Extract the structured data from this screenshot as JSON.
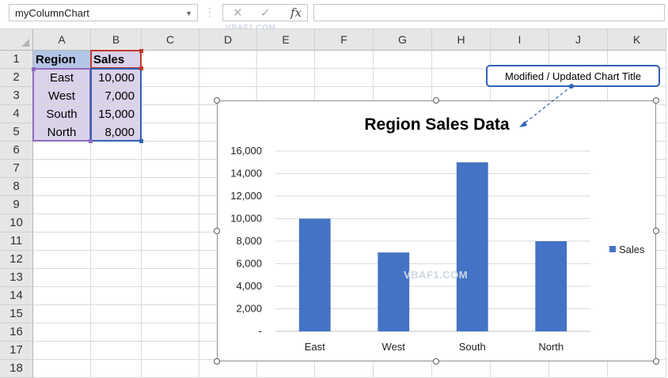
{
  "formula_bar": {
    "name_box": "myColumnChart",
    "cancel_glyph": "✕",
    "enter_glyph": "✓",
    "fx_label": "fx",
    "formula": ""
  },
  "columns": [
    "A",
    "B",
    "C",
    "D",
    "E",
    "F",
    "G",
    "H",
    "I",
    "J",
    "K"
  ],
  "rows": [
    "1",
    "2",
    "3",
    "4",
    "5",
    "6",
    "7",
    "8",
    "9",
    "10",
    "11",
    "12",
    "13",
    "14",
    "15",
    "16",
    "17",
    "18"
  ],
  "cells": {
    "A1": "Region",
    "B1": "Sales",
    "A2": "East",
    "B2": "10,000",
    "A3": "West",
    "B3": "7,000",
    "A4": "South",
    "B4": "15,000",
    "A5": "North",
    "B5": "8,000"
  },
  "callout": {
    "text": "Modified / Updated Chart Title"
  },
  "watermark": {
    "top": "VBAF1.COM",
    "chart": "VBAF1.COM"
  },
  "chart_data": {
    "type": "bar",
    "title": "Region Sales Data",
    "categories": [
      "East",
      "West",
      "South",
      "North"
    ],
    "series": [
      {
        "name": "Sales",
        "values": [
          10000,
          7000,
          15000,
          8000
        ],
        "color": "#4472c4"
      }
    ],
    "ylim": [
      0,
      16000
    ],
    "yticks": [
      0,
      2000,
      4000,
      6000,
      8000,
      10000,
      12000,
      14000,
      16000
    ],
    "ytick_labels": [
      "-",
      "2,000",
      "4,000",
      "6,000",
      "8,000",
      "10,000",
      "12,000",
      "14,000",
      "16,000"
    ],
    "grid": true,
    "legend": "right"
  },
  "colors": {
    "header_fill": "#b4c6e7",
    "data_fill": "#d9d2e9",
    "bar": "#4472c4",
    "callout_border": "#2f63b7"
  }
}
